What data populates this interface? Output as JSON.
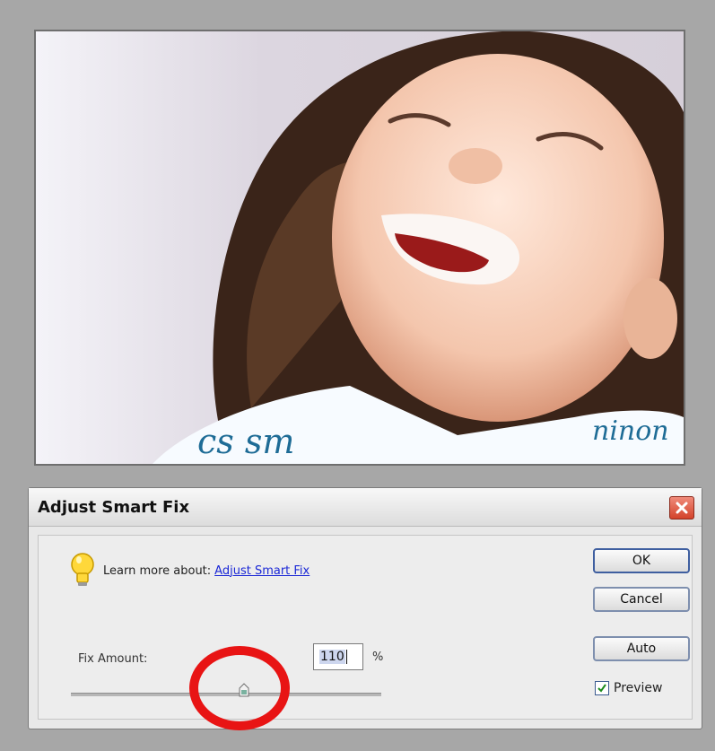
{
  "photo": {
    "alt_kind": "photo-preview"
  },
  "dialog": {
    "title": "Adjust Smart Fix",
    "hint_prefix": "Learn more about:",
    "hint_link": "Adjust Smart Fix",
    "fix_amount_label": "Fix Amount:",
    "fix_amount_value": "110",
    "fix_amount_unit": "%",
    "slider_fraction": 0.55,
    "buttons": {
      "ok": "OK",
      "cancel": "Cancel",
      "auto": "Auto"
    },
    "preview_label": "Preview",
    "preview_checked": true
  },
  "icons": [
    "close-icon",
    "lightbulb-icon",
    "checkmark-icon",
    "slider-thumb-icon"
  ],
  "colors": {
    "highlight": "#e81414",
    "link": "#1a27d6",
    "close": "#d3422a"
  }
}
